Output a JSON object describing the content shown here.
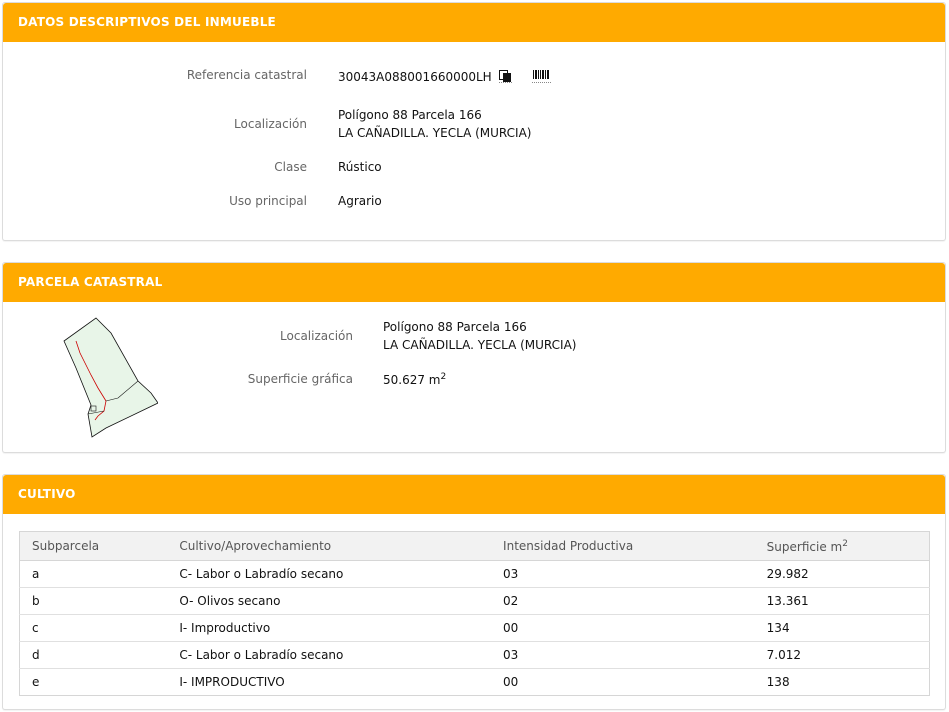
{
  "datos": {
    "title": "DATOS DESCRIPTIVOS DEL INMUEBLE",
    "fields": {
      "ref_label": "Referencia catastral",
      "ref_value": "30043A088001660000LH",
      "loc_label": "Localización",
      "loc_line1": "Polígono 88 Parcela 166",
      "loc_line2": "LA CAÑADILLA. YECLA (MURCIA)",
      "clase_label": "Clase",
      "clase_value": "Rústico",
      "uso_label": "Uso principal",
      "uso_value": "Agrario"
    },
    "icons": [
      "copy-icon",
      "barcode-icon"
    ]
  },
  "parcela": {
    "title": "PARCELA CATASTRAL",
    "loc_label": "Localización",
    "loc_line1": "Polígono 88 Parcela 166",
    "loc_line2": "LA CAÑADILLA. YECLA (MURCIA)",
    "sup_label": "Superficie gráfica",
    "sup_value": "50.627 m",
    "sup_exp": "2"
  },
  "cultivo": {
    "title": "CULTIVO",
    "headers": [
      "Subparcela",
      "Cultivo/Aprovechamiento",
      "Intensidad Productiva",
      "Superficie m"
    ],
    "header_exp": "2",
    "rows": [
      [
        "a",
        "C- Labor o Labradío secano",
        "03",
        "29.982"
      ],
      [
        "b",
        "O- Olivos secano",
        "02",
        "13.361"
      ],
      [
        "c",
        "I- Improductivo",
        "00",
        "134"
      ],
      [
        "d",
        "C- Labor o Labradío secano",
        "03",
        "7.012"
      ],
      [
        "e",
        "I- IMPRODUCTIVO",
        "00",
        "138"
      ]
    ]
  },
  "colors": {
    "header_bg": "#ffaa00",
    "parcel_fill": "#e8f5e8",
    "parcel_line": "#cc0000"
  }
}
